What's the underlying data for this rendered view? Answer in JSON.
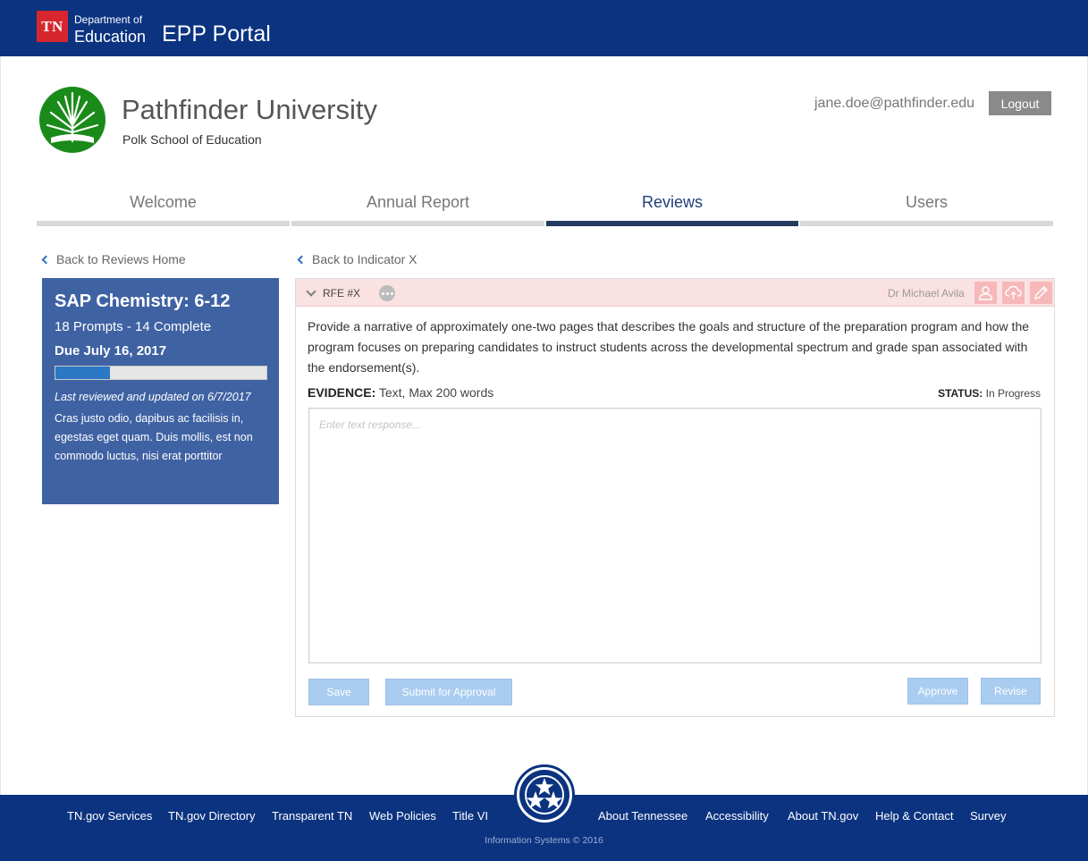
{
  "header": {
    "seal_text": "TN",
    "dept_line1": "Department of",
    "dept_line2": "Education",
    "portal_title": "EPP Portal"
  },
  "institution": {
    "name": "Pathfinder University",
    "school": "Polk School of Education",
    "user_email": "jane.doe@pathfinder.edu",
    "logout_label": "Logout"
  },
  "tabs": [
    {
      "label": "Welcome",
      "active": false
    },
    {
      "label": "Annual Report",
      "active": false
    },
    {
      "label": "Reviews",
      "active": true
    },
    {
      "label": "Users",
      "active": false
    }
  ],
  "nav": {
    "back_reviews": "Back to Reviews Home",
    "back_indicator": "Back to Indicator X"
  },
  "summary": {
    "title": "SAP Chemistry: 6-12",
    "prompts": "18 Prompts - 14 Complete",
    "due": "Due July 16, 2017",
    "progress_fraction": 0.26,
    "last_updated": "Last reviewed and updated on 6/7/2017",
    "description": "Cras justo odio, dapibus ac facilisis in, egestas eget quam. Duis mollis, est non commodo luctus, nisi erat porttitor"
  },
  "rfe": {
    "label": "RFE #X",
    "reviewer": "Dr Michael Avila",
    "prompt": "Provide a narrative of approximately one-two pages that describes the goals and structure of the preparation program and how the program focuses on preparing candidates to instruct students across the developmental spectrum and grade span associated with the endorsement(s).",
    "evidence_label": "EVIDENCE:",
    "evidence_value": " Text, Max 200 words",
    "status_label": "STATUS:",
    "status_value": " In Progress",
    "response_placeholder": "Enter text response...",
    "save_label": "Save",
    "submit_label": "Submit for Approval",
    "approve_label": "Approve",
    "revise_label": "Revise"
  },
  "footer": {
    "links_left": [
      "TN.gov Services",
      "TN.gov Directory",
      "Transparent TN",
      "Web Policies",
      "Title VI"
    ],
    "links_right": [
      "About Tennessee",
      "Accessibility",
      "About TN.gov",
      "Help & Contact",
      "Survey"
    ],
    "copyright": "Information Systems © 2016"
  },
  "colors": {
    "brand_navy": "#0b3380",
    "tn_red": "#d7262e",
    "card_blue": "#3f62a3",
    "progress_blue": "#2b79c4",
    "header_pink": "#fbe2e2",
    "button_light_blue": "#aaccf0",
    "tree_green": "#1a8a1a"
  },
  "icons": {
    "rfe_toggle": "chevron-down-icon",
    "rfe_more": "more-options-icon",
    "assign": "user-icon",
    "upload": "cloud-upload-icon",
    "edit": "pencil-icon",
    "back": "chevron-left-icon",
    "university_logo": "tree-logo-icon",
    "footer_seal": "tristar-icon"
  }
}
